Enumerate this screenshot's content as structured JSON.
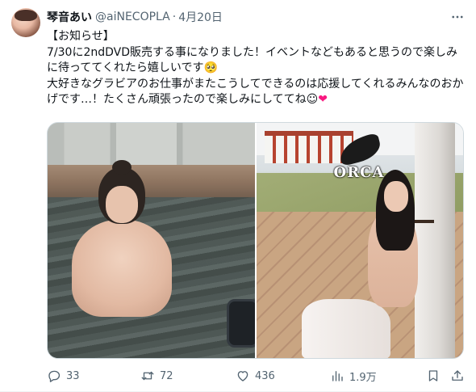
{
  "user": {
    "display_name": "琴音あい",
    "handle": "@aiNECOPLA",
    "separator": "·",
    "date": "4月20日",
    "avatar_icon": "avatar"
  },
  "tweet": {
    "text": "【お知らせ】\n7/30に2ndDVD販売する事になりました！イベントなどもあると思うので楽しみに待っててくれたら嬉しいです🥺\n大好きなグラビアのお仕事がまたこうしてできるのは応援してくれるみんなのおかげです…！たくさん頑張ったので楽しみにしててね☺",
    "heart_emoji": "❤",
    "heart_color": "#f91880"
  },
  "media": {
    "logo_text": "ORCA"
  },
  "actions": {
    "reply_count": "33",
    "retweet_count": "72",
    "like_count": "436",
    "views_count": "1.9万",
    "reply_icon": "reply-icon",
    "retweet_icon": "retweet-icon",
    "like_icon": "heart-icon",
    "views_icon": "views-icon",
    "bookmark_icon": "bookmark-icon",
    "share_icon": "share-icon"
  },
  "colors": {
    "text": "#0f1419",
    "muted": "#536471",
    "border": "#cfd9de"
  }
}
